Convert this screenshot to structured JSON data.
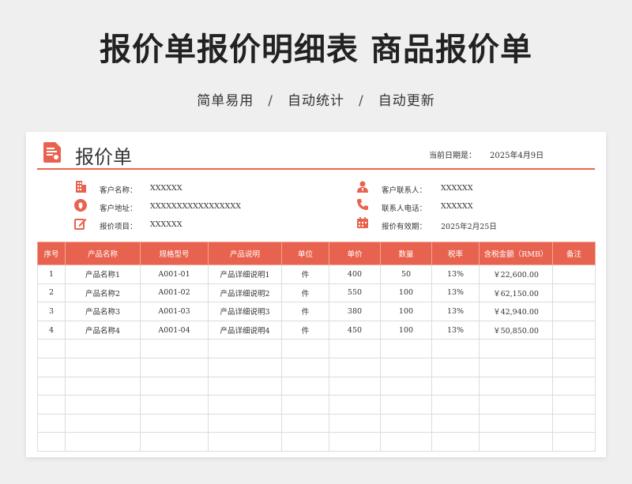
{
  "header": {
    "title": "报价单报价明细表 商品报价单",
    "tagline": [
      "简单易用",
      "自动统计",
      "自动更新"
    ],
    "separator": "/"
  },
  "sheet": {
    "title": "报价单",
    "date_label": "当前日期是：",
    "date_value": "2025年4月9日",
    "accent_color": "#e8634f",
    "info_left": [
      {
        "icon": "building-icon",
        "label": "客户名称：",
        "value": "XXXXXX"
      },
      {
        "icon": "location-pin-icon",
        "label": "客户地址：",
        "value": "XXXXXXXXXXXXXXXXX"
      },
      {
        "icon": "edit-icon",
        "label": "报价项目：",
        "value": "XXXXXX"
      }
    ],
    "info_right": [
      {
        "icon": "contact-person-icon",
        "label": "客户联系人：",
        "value": "XXXXXX"
      },
      {
        "icon": "phone-icon",
        "label": "联系人电话：",
        "value": "XXXXXX"
      },
      {
        "icon": "calendar-icon",
        "label": "报价有效期：",
        "value": "2025年2月25日"
      }
    ]
  },
  "table": {
    "columns": [
      "序号",
      "产品名称",
      "规格型号",
      "产品说明",
      "单位",
      "单价",
      "数量",
      "税率",
      "含税金额（RMB）",
      "备注"
    ],
    "rows": [
      [
        "1",
        "产品名称1",
        "A001-01",
        "产品详细说明1",
        "件",
        "400",
        "50",
        "13%",
        "￥22,600.00",
        ""
      ],
      [
        "2",
        "产品名称2",
        "A001-02",
        "产品详细说明2",
        "件",
        "550",
        "100",
        "13%",
        "￥62,150.00",
        ""
      ],
      [
        "3",
        "产品名称3",
        "A001-03",
        "产品详细说明3",
        "件",
        "380",
        "100",
        "13%",
        "￥42,940.00",
        ""
      ],
      [
        "4",
        "产品名称4",
        "A001-04",
        "产品详细说明4",
        "件",
        "450",
        "100",
        "13%",
        "￥50,850.00",
        ""
      ]
    ],
    "empty_rows": 6
  }
}
